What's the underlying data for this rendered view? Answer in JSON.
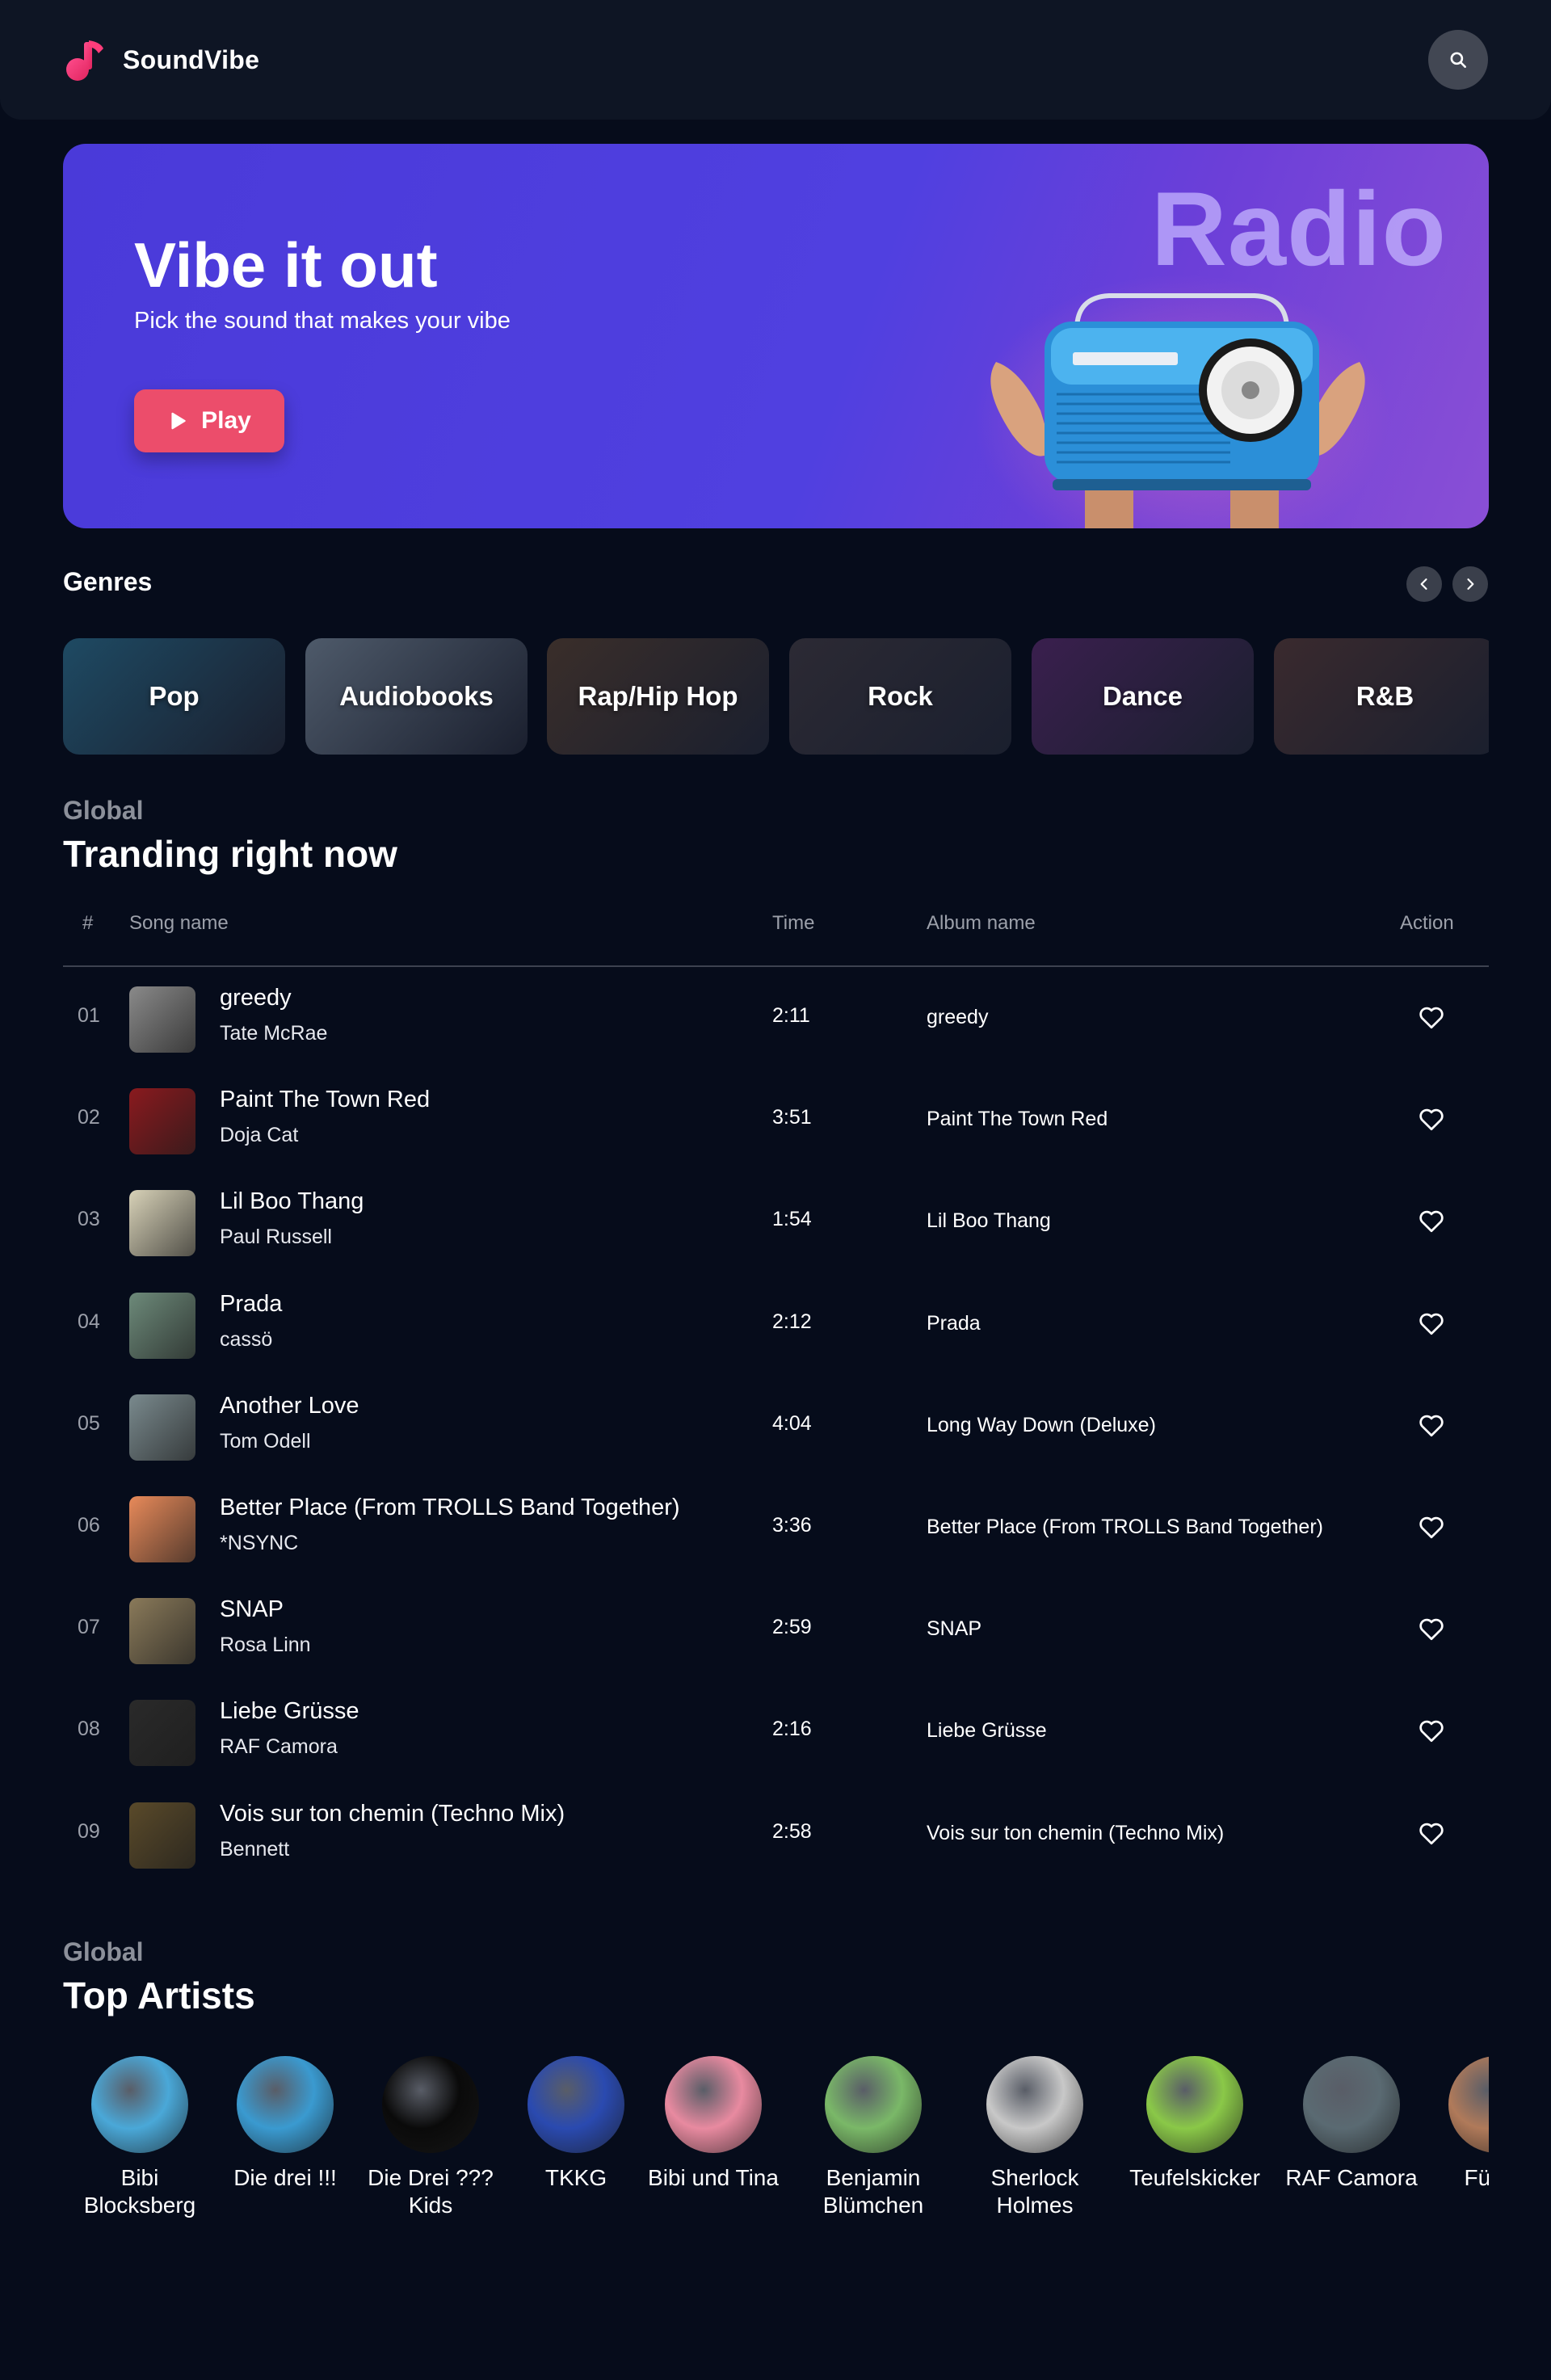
{
  "header": {
    "brand": "SoundVibe"
  },
  "hero": {
    "title": "Vibe it out",
    "subtitle": "Pick the sound that makes your vibe",
    "play_label": "Play",
    "art_word": "Radio"
  },
  "genres": {
    "title": "Genres",
    "items": [
      {
        "label": "Pop",
        "bg": "#1e4a63"
      },
      {
        "label": "Audiobooks",
        "bg": "#4e5a6a"
      },
      {
        "label": "Rap/Hip Hop",
        "bg": "#3a2e2a"
      },
      {
        "label": "Rock",
        "bg": "#2c2a34"
      },
      {
        "label": "Dance",
        "bg": "#3a1f4e"
      },
      {
        "label": "R&B",
        "bg": "#3a2a2e"
      }
    ]
  },
  "trending": {
    "kicker": "Global",
    "title": "Tranding right now",
    "columns": {
      "rank": "#",
      "song": "Song name",
      "time": "Time",
      "album": "Album name",
      "action": "Action"
    },
    "rows": [
      {
        "rank": "01",
        "song": "greedy",
        "artist": "Tate McRae",
        "time": "2:11",
        "album": "greedy",
        "cover": "#8a8a8a"
      },
      {
        "rank": "02",
        "song": "Paint The Town Red",
        "artist": "Doja Cat",
        "time": "3:51",
        "album": "Paint The Town Red",
        "cover": "#8a1a1e"
      },
      {
        "rank": "03",
        "song": "Lil Boo Thang",
        "artist": "Paul Russell",
        "time": "1:54",
        "album": "Lil Boo Thang",
        "cover": "#d8d2b8"
      },
      {
        "rank": "04",
        "song": "Prada",
        "artist": "cassö",
        "time": "2:12",
        "album": "Prada",
        "cover": "#6d8a7a"
      },
      {
        "rank": "05",
        "song": "Another Love",
        "artist": "Tom Odell",
        "time": "4:04",
        "album": "Long Way Down (Deluxe)",
        "cover": "#7a8a8e"
      },
      {
        "rank": "06",
        "song": "Better Place (From TROLLS Band Together)",
        "artist": "*NSYNC",
        "time": "3:36",
        "album": "Better Place (From TROLLS Band Together)",
        "cover": "#e88a5a"
      },
      {
        "rank": "07",
        "song": "SNAP",
        "artist": "Rosa Linn",
        "time": "2:59",
        "album": "SNAP",
        "cover": "#8a7a5a"
      },
      {
        "rank": "08",
        "song": "Liebe Grüsse",
        "artist": "RAF Camora",
        "time": "2:16",
        "album": "Liebe Grüsse",
        "cover": "#2a2a2a"
      },
      {
        "rank": "09",
        "song": "Vois sur ton chemin (Techno Mix)",
        "artist": "Bennett",
        "time": "2:58",
        "album": "Vois sur ton chemin (Techno Mix)",
        "cover": "#5a4a2a"
      }
    ]
  },
  "artists": {
    "kicker": "Global",
    "title": "Top Artists",
    "items": [
      {
        "name": "Bibi Blocksberg",
        "bg": "#4aa8d8"
      },
      {
        "name": "Die drei !!!",
        "bg": "#3a9ad0"
      },
      {
        "name": "Die Drei ??? Kids",
        "bg": "#0a0a0a"
      },
      {
        "name": "TKKG",
        "bg": "#2a4ab0"
      },
      {
        "name": "Bibi und Tina",
        "bg": "#e88aa0"
      },
      {
        "name": "Benjamin Blümchen",
        "bg": "#7ab868"
      },
      {
        "name": "Sherlock Holmes",
        "bg": "#c8c8c8"
      },
      {
        "name": "Teufelskicker",
        "bg": "#8ac848"
      },
      {
        "name": "RAF Camora",
        "bg": "#5a6a72"
      },
      {
        "name": "Fünf F",
        "bg": "#b07a5a"
      }
    ]
  },
  "colors": {
    "accent": "#ec4d6b",
    "hero_bg": "#4f3fe0",
    "page_bg": "#060c1b"
  }
}
